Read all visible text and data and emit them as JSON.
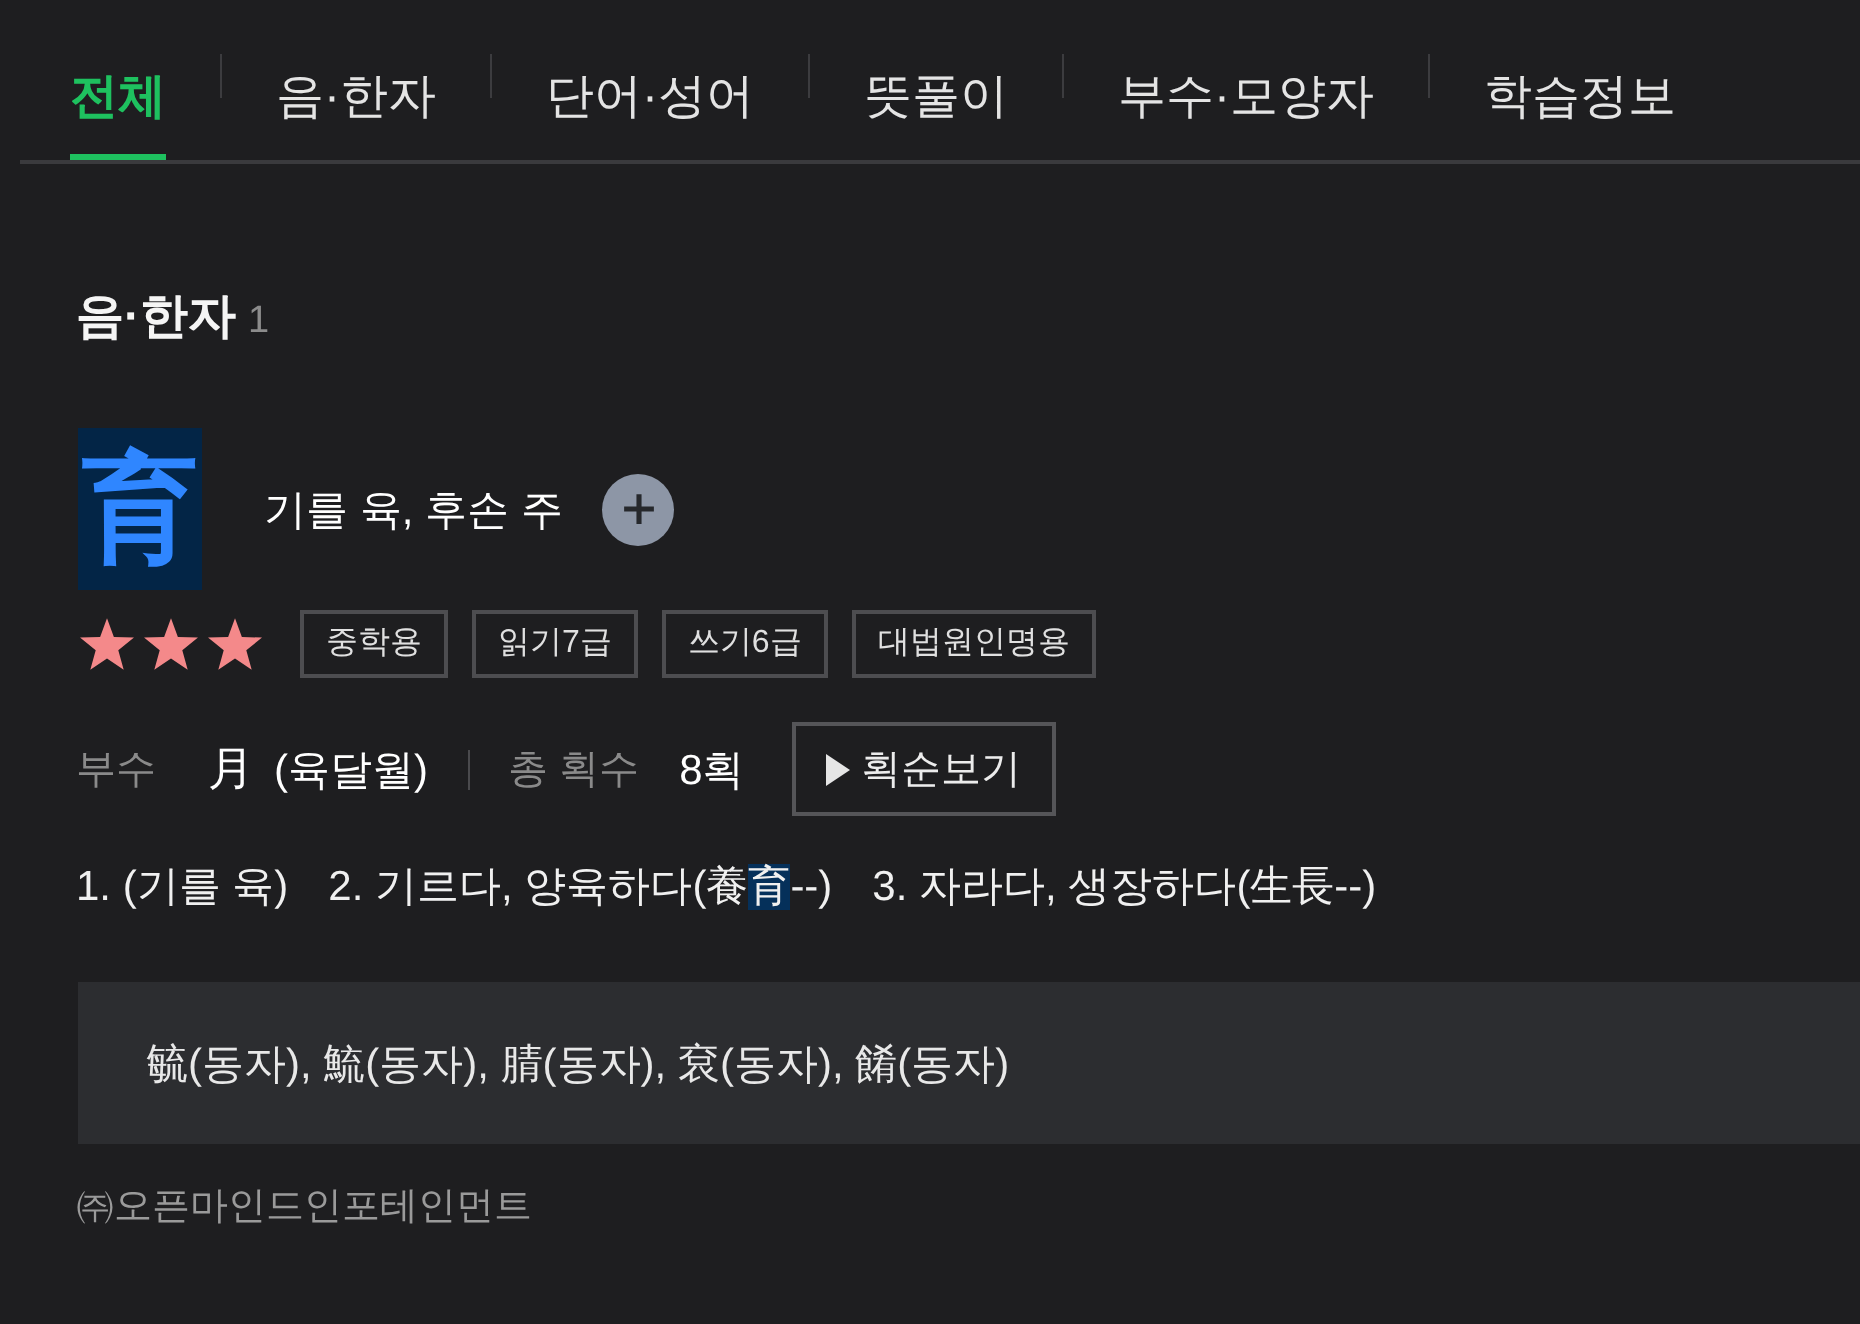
{
  "tabs": [
    {
      "label": "전체",
      "selected": true
    },
    {
      "label": "음·한자",
      "selected": false
    },
    {
      "label": "단어·성어",
      "selected": false
    },
    {
      "label": "뜻풀이",
      "selected": false
    },
    {
      "label": "부수·모양자",
      "selected": false
    },
    {
      "label": "학습정보",
      "selected": false
    }
  ],
  "section": {
    "title": "음·한자",
    "count": "1"
  },
  "entry": {
    "hanja": "育",
    "reading": "기를 육, 후손 주",
    "stars": 3,
    "tags": [
      "중학용",
      "읽기7급",
      "쓰기6급",
      "대법원인명용"
    ],
    "radical": {
      "label": "부수",
      "character": "月",
      "name": "(육달월)"
    },
    "strokes": {
      "label": "총 획수",
      "value": "8획"
    },
    "stroke_order_button": "획순보기",
    "meanings": [
      {
        "parts": [
          {
            "text": "1. (기를 육)",
            "highlighted": false
          }
        ]
      },
      {
        "parts": [
          {
            "text": "2. 기르다, 양육하다(養",
            "highlighted": false
          },
          {
            "text": "育",
            "highlighted": true
          },
          {
            "text": "--)",
            "highlighted": false
          }
        ]
      },
      {
        "parts": [
          {
            "text": "3. 자라다, 생장하다(生長--)",
            "highlighted": false
          }
        ]
      }
    ],
    "variants": "毓(동자), 鯍(동자), 腈(동자), 袞(동자), 餚(동자)"
  },
  "footer": "㈜오픈마인드인포테인먼트"
}
